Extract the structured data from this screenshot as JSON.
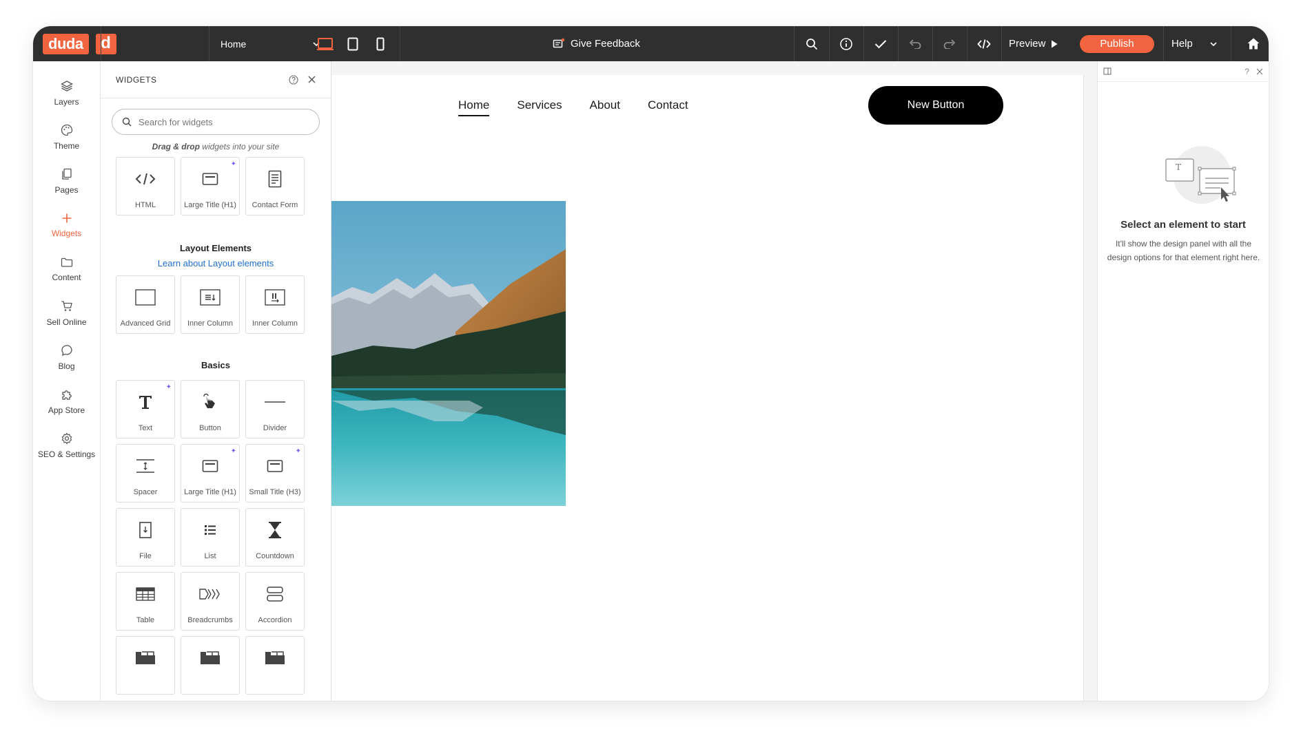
{
  "brand": {
    "logo_text": "duda",
    "logo_letter": "d",
    "accent": "#f26440",
    "dark": "#2f2f2f"
  },
  "topbar": {
    "page_select": "Home",
    "feedback_label": "Give Feedback",
    "preview_label": "Preview",
    "publish_label": "Publish",
    "help_label": "Help"
  },
  "rail": {
    "items": [
      {
        "label": "Layers",
        "icon": "layers-icon"
      },
      {
        "label": "Theme",
        "icon": "palette-icon"
      },
      {
        "label": "Pages",
        "icon": "pages-icon"
      },
      {
        "label": "Widgets",
        "icon": "plus-icon",
        "active": true
      },
      {
        "label": "Content",
        "icon": "folder-icon"
      },
      {
        "label": "Sell Online",
        "icon": "cart-icon"
      },
      {
        "label": "Blog",
        "icon": "chat-bubble-icon"
      },
      {
        "label": "App Store",
        "icon": "puzzle-icon"
      },
      {
        "label": "SEO & Settings",
        "icon": "gear-icon"
      }
    ]
  },
  "widgets_panel": {
    "title": "WIDGETS",
    "search_placeholder": "Search for widgets",
    "drag_hint_bold": "Drag & drop",
    "drag_hint_rest": " widgets into your site",
    "top_tiles": [
      {
        "label": "HTML",
        "icon": "code-icon"
      },
      {
        "label": "Large Title (H1)",
        "icon": "title-box-icon",
        "ai": true
      },
      {
        "label": "Contact Form",
        "icon": "form-icon"
      }
    ],
    "layout_title": "Layout Elements",
    "layout_link": "Learn about Layout elements",
    "layout_tiles": [
      {
        "label": "Advanced Grid",
        "icon": "grid-box-icon"
      },
      {
        "label": "Inner Column",
        "icon": "inner-column-icon"
      },
      {
        "label": "Inner Column",
        "icon": "inner-column-alt-icon"
      }
    ],
    "basics_title": "Basics",
    "basics_tiles": [
      {
        "label": "Text",
        "icon": "text-t-icon",
        "ai": true
      },
      {
        "label": "Button",
        "icon": "hand-pointer-icon"
      },
      {
        "label": "Divider",
        "icon": "divider-line-icon"
      },
      {
        "label": "Spacer",
        "icon": "spacer-icon"
      },
      {
        "label": "Large Title (H1)",
        "icon": "title-box-icon",
        "ai": true
      },
      {
        "label": "Small Title (H3)",
        "icon": "title-box-icon",
        "ai": true
      },
      {
        "label": "File",
        "icon": "file-icon"
      },
      {
        "label": "List",
        "icon": "list-icon"
      },
      {
        "label": "Countdown",
        "icon": "hourglass-icon"
      },
      {
        "label": "Table",
        "icon": "table-icon"
      },
      {
        "label": "Breadcrumbs",
        "icon": "breadcrumbs-icon"
      },
      {
        "label": "Accordion",
        "icon": "accordion-icon"
      },
      {
        "label": "",
        "icon": "tabs-icon"
      },
      {
        "label": "",
        "icon": "tabs-icon"
      },
      {
        "label": "",
        "icon": "tabs-icon"
      }
    ]
  },
  "site": {
    "nav": [
      "Home",
      "Services",
      "About",
      "Contact"
    ],
    "button_label": "New Button"
  },
  "design_panel": {
    "title": "Select an element to start",
    "description": "It'll show the design panel with all the design options for that element right here."
  }
}
